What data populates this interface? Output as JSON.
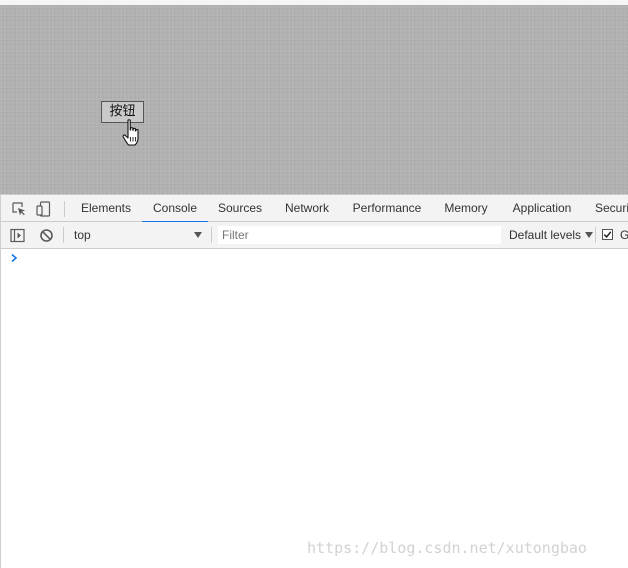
{
  "page": {
    "button_label": "按钮"
  },
  "devtools": {
    "tabs": [
      {
        "label": "Elements"
      },
      {
        "label": "Console",
        "active": true
      },
      {
        "label": "Sources"
      },
      {
        "label": "Network"
      },
      {
        "label": "Performance"
      },
      {
        "label": "Memory"
      },
      {
        "label": "Application"
      },
      {
        "label": "Securi"
      }
    ],
    "toolbar_icons": [
      "inspect-element-icon",
      "device-toggle-icon"
    ],
    "console_toolbar": {
      "sidebar_icon": "console-sidebar-icon",
      "clear_icon": "clear-console-icon",
      "context": "top",
      "filter_placeholder": "Filter",
      "levels": "Default levels",
      "group_checkbox_checked": true,
      "group_label": "G"
    },
    "prompt_icon": "chevron-right-icon"
  },
  "watermark": "https://blog.csdn.net/xutongbao",
  "colors": {
    "viewport_bg": "#b1b1b1",
    "active_tab_underline": "#1a73e8",
    "prompt": "#1a73e8",
    "watermark": "#d2d2d2"
  }
}
